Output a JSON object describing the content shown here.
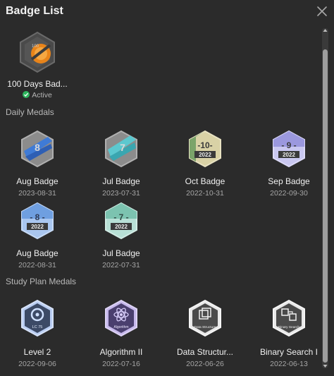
{
  "header": {
    "title": "Badge List"
  },
  "featured": {
    "name": "100 Days Bad...",
    "status": "Active",
    "icon": "100-days-badge"
  },
  "sections": {
    "daily": "Daily Medals",
    "study": "Study Plan Medals"
  },
  "daily_badges": [
    {
      "name": "Aug Badge",
      "date": "2023-08-31",
      "label": "8",
      "icon": "aug-2023-badge"
    },
    {
      "name": "Jul Badge",
      "date": "2023-07-31",
      "label": "7",
      "icon": "jul-2023-badge"
    },
    {
      "name": "Oct Badge",
      "date": "2022-10-31",
      "label": "-10-",
      "year": "2022",
      "icon": "oct-2022-badge"
    },
    {
      "name": "Sep Badge",
      "date": "2022-09-30",
      "label": "- 9 -",
      "year": "2022",
      "icon": "sep-2022-badge"
    },
    {
      "name": "Aug Badge",
      "date": "2022-08-31",
      "label": "- 8 -",
      "year": "2022",
      "icon": "aug-2022-badge"
    },
    {
      "name": "Jul Badge",
      "date": "2022-07-31",
      "label": "- 7 -",
      "year": "2022",
      "icon": "jul-2022-badge"
    }
  ],
  "study_badges": [
    {
      "name": "Level 2",
      "date": "2022-09-06",
      "caption": "LC 75",
      "icon": "lc75-badge"
    },
    {
      "name": "Algorithm II",
      "date": "2022-07-16",
      "caption": "Algorithm",
      "icon": "algorithm-badge"
    },
    {
      "name": "Data Structur...",
      "date": "2022-06-26",
      "caption": "Data Structure",
      "icon": "data-structure-badge"
    },
    {
      "name": "Binary Search I",
      "date": "2022-06-13",
      "caption": "Binary Search",
      "icon": "binary-search-badge"
    }
  ],
  "colors": {
    "background": "#2b2b2b",
    "active": "#2db55d"
  }
}
